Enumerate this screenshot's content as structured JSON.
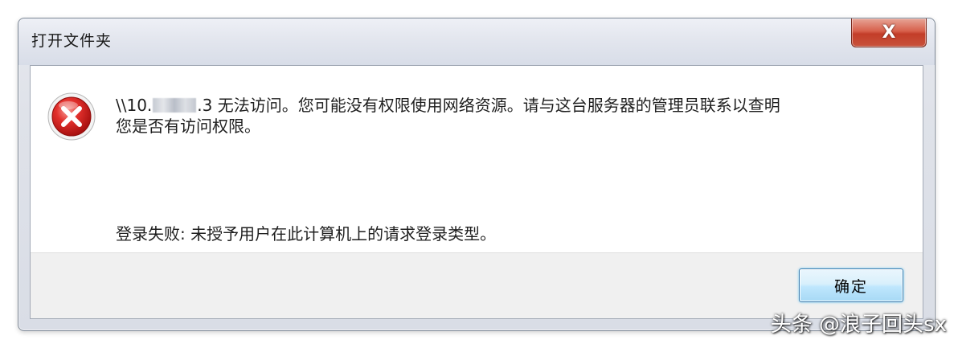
{
  "window": {
    "title": "打开文件夹",
    "close_glyph": "X"
  },
  "message": {
    "line1_prefix": "\\\\10.",
    "line1_suffix": ".3 无法访问。您可能没有权限使用网络资源。请与这台服务器的管理员联系以查明",
    "line2": "您是否有访问权限。",
    "detail": "登录失败: 未授予用户在此计算机上的请求登录类型。"
  },
  "icons": {
    "error": "error-icon",
    "close": "close-icon"
  },
  "buttons": {
    "ok_label": "确定"
  },
  "watermark": {
    "text": "头条 @浪子回头sx"
  },
  "colors": {
    "error_red": "#d0191b",
    "close_red": "#c33d28",
    "ok_border": "#3c7fb1"
  }
}
